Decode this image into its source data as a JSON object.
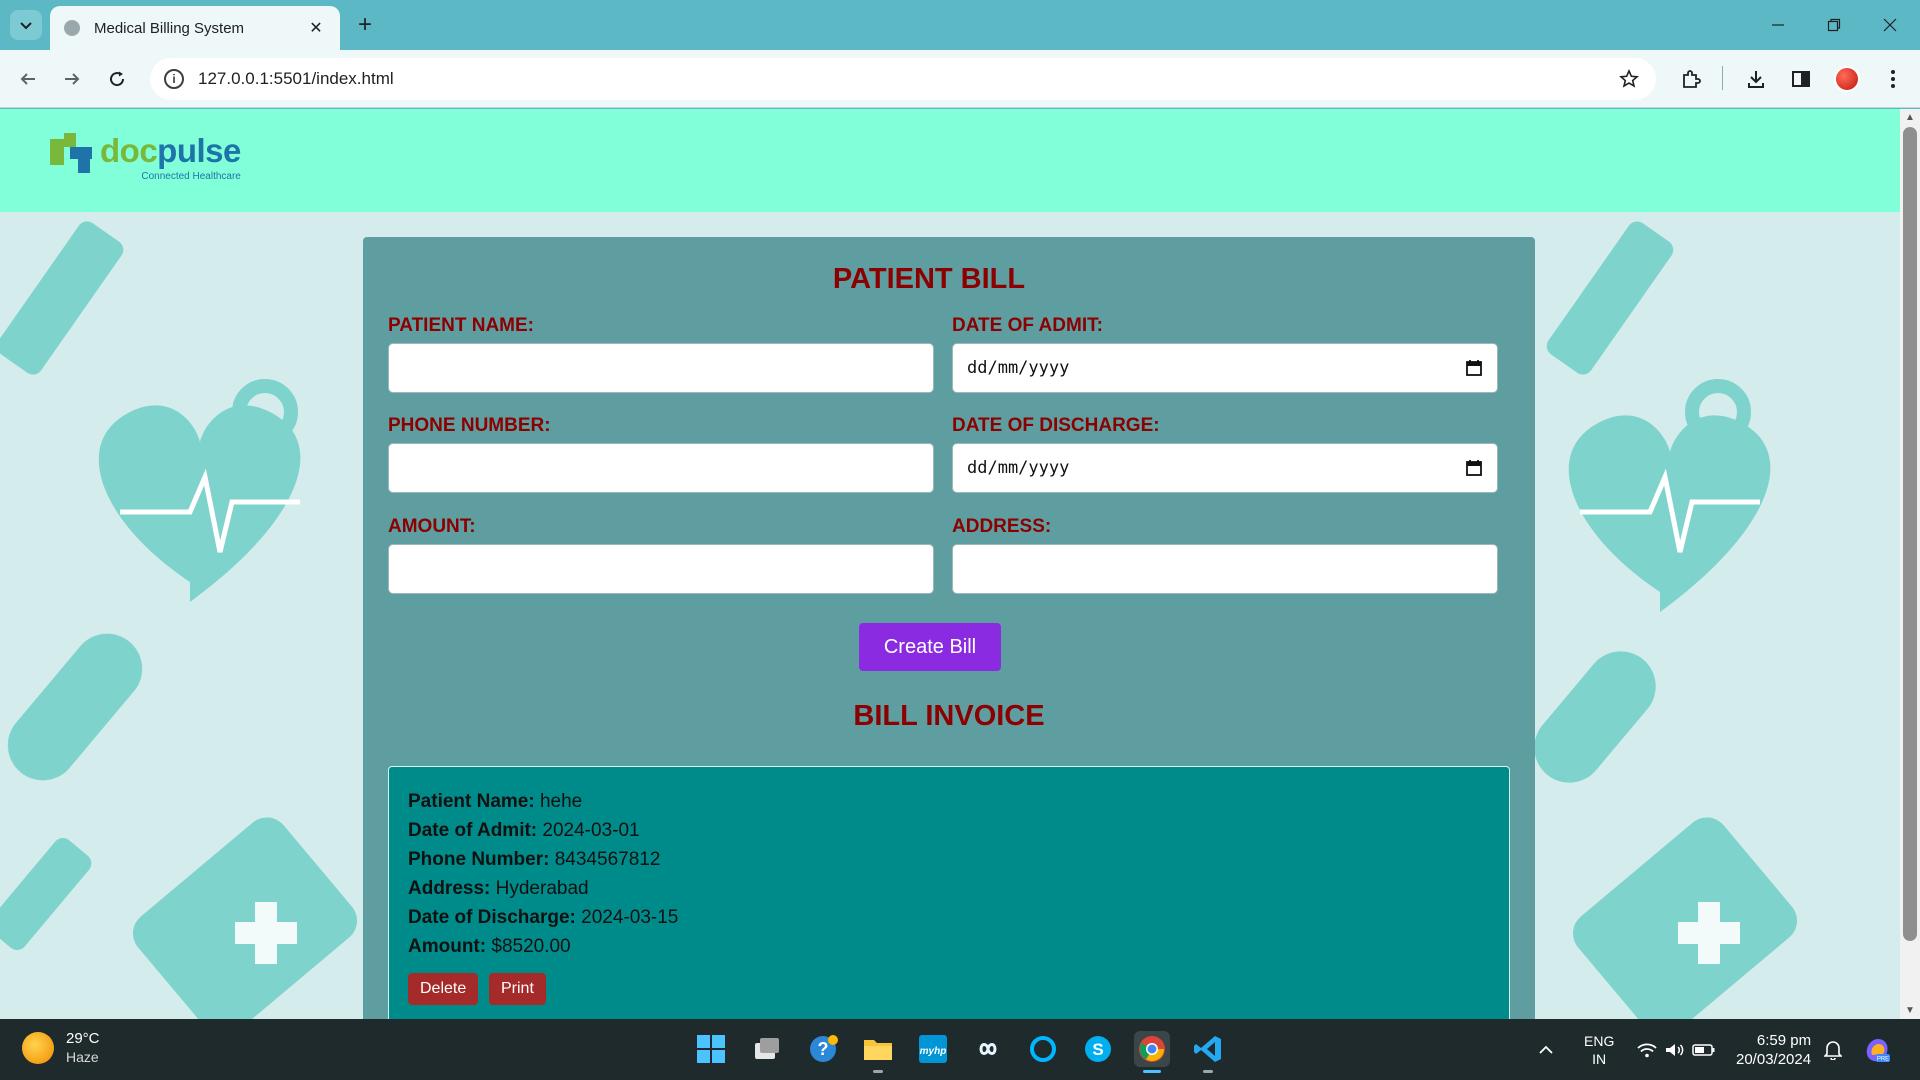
{
  "browser": {
    "tab_title": "Medical Billing System",
    "tab_close": "✕",
    "new_tab": "+",
    "url": "127.0.0.1:5501/index.html"
  },
  "site": {
    "logo_part1": "doc",
    "logo_part2": "pulse",
    "logo_tagline": "Connected Healthcare",
    "colors": {
      "header_bg": "#80ffd8",
      "card_bg": "#5f9ea0",
      "heading": "#8b0000",
      "button": "#8a2be2",
      "invoice_bg": "#008b8b",
      "action_button": "#a52a2a"
    }
  },
  "form": {
    "title": "PATIENT BILL",
    "patient_name_label": "PATIENT NAME:",
    "patient_name_value": "",
    "date_of_admit_label": "DATE OF ADMIT:",
    "date_of_admit_placeholder": "dd/mm/yyyy",
    "phone_label": "PHONE NUMBER:",
    "phone_value": "",
    "date_of_discharge_label": "DATE OF DISCHARGE:",
    "date_of_discharge_placeholder": "dd/mm/yyyy",
    "amount_label": "AMOUNT:",
    "amount_value": "",
    "address_label": "ADDRESS:",
    "address_value": "",
    "submit_label": "Create Bill"
  },
  "invoice": {
    "title": "BILL INVOICE",
    "lines": [
      {
        "label": "Patient Name:",
        "value": "hehe"
      },
      {
        "label": "Date of Admit:",
        "value": "2024-03-01"
      },
      {
        "label": "Phone Number:",
        "value": "8434567812"
      },
      {
        "label": "Address:",
        "value": "Hyderabad"
      },
      {
        "label": "Date of Discharge:",
        "value": "2024-03-15"
      },
      {
        "label": "Amount:",
        "value": "$8520.00"
      }
    ],
    "delete_label": "Delete",
    "print_label": "Print"
  },
  "taskbar": {
    "temperature": "29°C",
    "condition": "Haze",
    "lang_1": "ENG",
    "lang_2": "IN",
    "time": "6:59 pm",
    "date": "20/03/2024"
  }
}
